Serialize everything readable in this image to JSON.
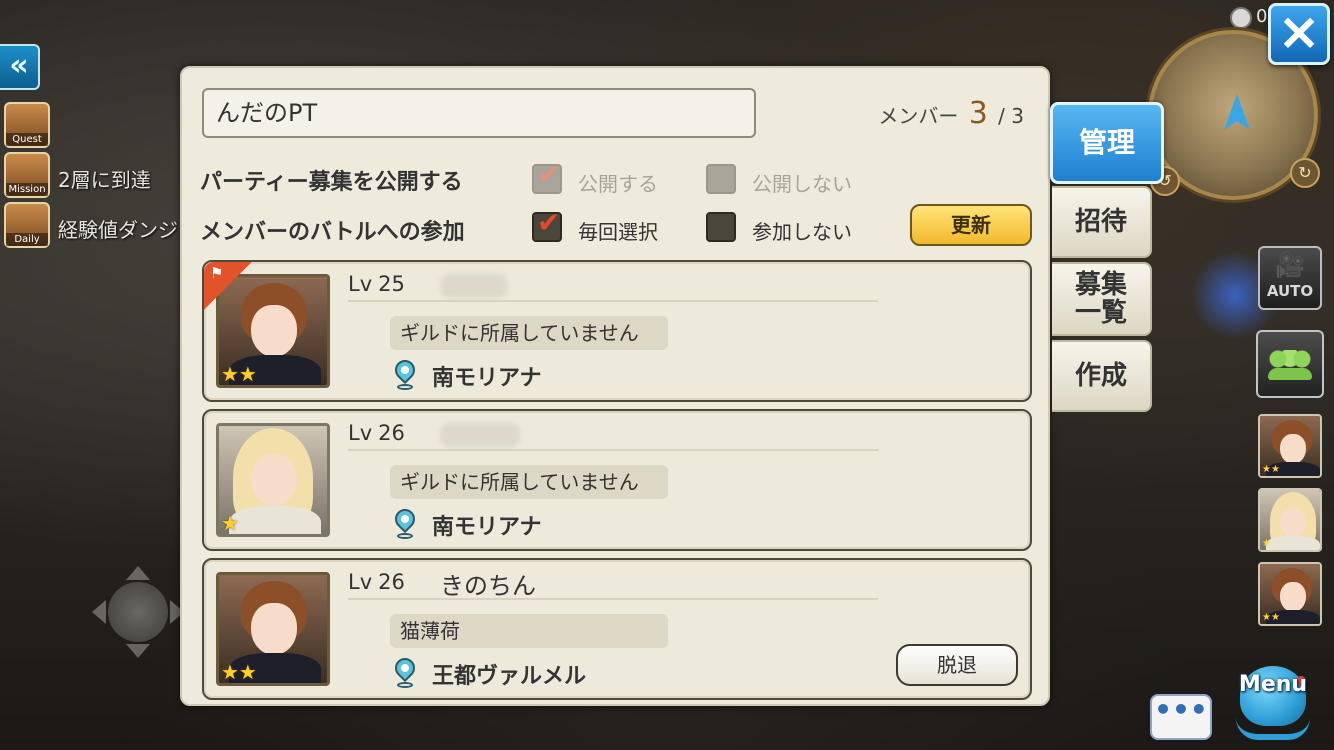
{
  "hud": {
    "clock_text": "0",
    "side_menu": [
      {
        "caption": "Quest",
        "text": ""
      },
      {
        "caption": "Mission",
        "text": "2層に到達"
      },
      {
        "caption": "Daily",
        "text": "経験値ダンジ"
      }
    ],
    "auto_label": "AUTO",
    "menu_label": "Menu",
    "chat_label": "•••",
    "back_label": "«"
  },
  "party": {
    "name": "んだのPT",
    "member_label": "メンバー",
    "member_current": "3",
    "member_max": "/ 3"
  },
  "options": {
    "recruit_label": "パーティー募集を公開する",
    "recruit_yes": "公開する",
    "recruit_no": "公開しない",
    "battle_label": "メンバーのバトルへの参加",
    "battle_yes": "毎回選択",
    "battle_no": "参加しない",
    "update_button": "更新"
  },
  "members": [
    {
      "lv_label": "Lv",
      "level": "25",
      "name": "",
      "guild": "ギルドに所属していません",
      "location": "南モリアナ",
      "stars": "★★",
      "leader": true,
      "action": ""
    },
    {
      "lv_label": "Lv",
      "level": "26",
      "name": "",
      "guild": "ギルドに所属していません",
      "location": "南モリアナ",
      "stars": "★",
      "leader": false,
      "action": ""
    },
    {
      "lv_label": "Lv",
      "level": "26",
      "name": "きのちん",
      "guild": "猫薄荷",
      "location": "王都ヴァルメル",
      "stars": "★★",
      "leader": false,
      "action": "脱退"
    }
  ],
  "tabs": [
    {
      "label": "管理",
      "active": true
    },
    {
      "label": "招待",
      "active": false
    },
    {
      "label": "募集\n一覧",
      "active": false
    },
    {
      "label": "作成",
      "active": false
    }
  ],
  "mini_party": [
    {
      "stars": "★★"
    },
    {
      "stars": "★"
    },
    {
      "stars": "★★"
    }
  ],
  "icons": {
    "close": "close-icon",
    "check": "checkmark-icon",
    "location_pin": "location-pin-icon",
    "leader": "leader-flag-icon"
  },
  "colors": {
    "panel_bg": "#efebdc",
    "accent_blue": "#1f7fd0",
    "update_yellow": "#f2b82a",
    "check_red": "#e34a2a"
  }
}
